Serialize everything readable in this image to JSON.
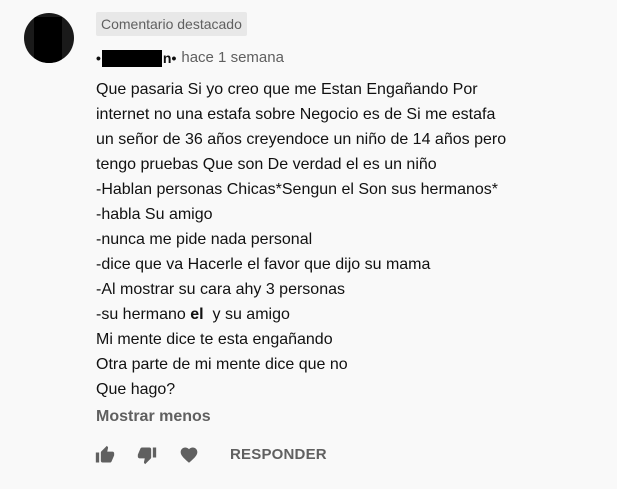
{
  "badge": {
    "label": "Comentario destacado"
  },
  "author": {
    "prefix": "•",
    "suffix": "n•"
  },
  "meta": {
    "time": "hace 1 semana"
  },
  "comment": {
    "lines": [
      "Que pasaria Si yo creo que me Estan Engañando Por",
      "internet no una estafa sobre Negocio es de Si me estafa",
      "un señor de 36 años creyendoce un niño de 14 años pero",
      "tengo pruebas Que son De verdad el es un niño",
      "-Hablan personas Chicas*Sengun el Son sus hermanos*",
      "-habla Su amigo",
      "-nunca me pide nada personal",
      "-dice que va Hacerle el favor que dijo su mama",
      "-Al mostrar su cara ahy 3 personas"
    ],
    "line10_before": "-su hermano ",
    "line10_bold": "el",
    "line10_after": "  y su amigo",
    "lines_end": [
      "Mi mente dice te esta engañando",
      "Otra parte de mi mente dice que no",
      "Que hago?"
    ]
  },
  "show_less": {
    "label": "Mostrar menos"
  },
  "actions": {
    "reply_label": "RESPONDER",
    "icons": [
      "thumbs-up-icon",
      "thumbs-down-icon",
      "heart-icon"
    ]
  },
  "colors": {
    "background": "#f9f9f9",
    "badge_bg": "#e8e8e8",
    "secondary_text": "#606060",
    "primary_text": "#0f0f0f"
  }
}
